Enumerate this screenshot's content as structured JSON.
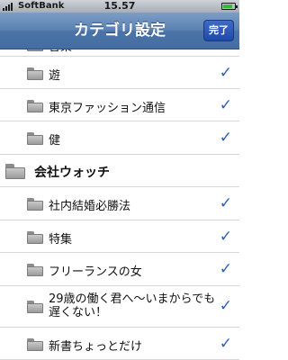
{
  "status_bar": {
    "carrier": "SoftBank",
    "time": "15.57",
    "battery_level": 0.7
  },
  "nav": {
    "title": "カテゴリ設定",
    "done_label": "完了"
  },
  "list": {
    "partial_top_label": "音楽",
    "items": [
      {
        "label": "遊",
        "checked": true
      },
      {
        "label": "東京ファッション通信",
        "checked": true
      },
      {
        "label": "健",
        "checked": true
      },
      {
        "label": "会社ウォッチ",
        "checked": false,
        "group": true
      },
      {
        "label": "社内結婚必勝法",
        "checked": true
      },
      {
        "label": "特集",
        "checked": true
      },
      {
        "label": "フリーランスの女",
        "checked": true
      },
      {
        "label": "29歳の働く君へ〜いまからでも遅くない！",
        "checked": true
      },
      {
        "label": "新書ちょっとだけ",
        "checked": true
      }
    ],
    "check_symbol": "✓",
    "colors": {
      "check": "#2d5fb5",
      "nav_bar": "#5b82b3",
      "done_button": "#1f49a8"
    }
  }
}
